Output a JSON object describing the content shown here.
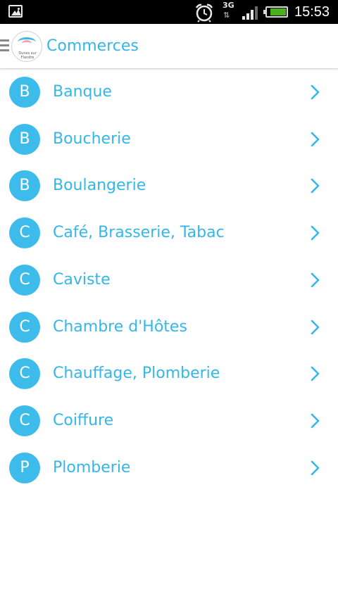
{
  "status_bar": {
    "time": "15:53",
    "network": "3G",
    "network_arrows": "⇅",
    "signal_level": 0.75,
    "battery_level": 0.85,
    "colors": {
      "background": "#000000",
      "battery": "#4caf1e"
    },
    "icons": [
      "gallery-notification-icon",
      "alarm-icon",
      "network-3g-icon",
      "signal-icon",
      "battery-icon"
    ]
  },
  "action_bar": {
    "title": "Commerces",
    "logo_text": "Dunes sur Flandre",
    "icons": [
      "drawer-menu-icon",
      "app-logo"
    ]
  },
  "list": {
    "items": [
      {
        "letter": "B",
        "label": "Banque"
      },
      {
        "letter": "B",
        "label": "Boucherie"
      },
      {
        "letter": "B",
        "label": "Boulangerie"
      },
      {
        "letter": "C",
        "label": "Café, Brasserie, Tabac"
      },
      {
        "letter": "C",
        "label": "Caviste"
      },
      {
        "letter": "C",
        "label": "Chambre d'Hôtes"
      },
      {
        "letter": "C",
        "label": "Chauffage, Plomberie"
      },
      {
        "letter": "C",
        "label": "Coiffure"
      },
      {
        "letter": "P",
        "label": "Plomberie"
      }
    ],
    "item_icon": "chevron-right-icon"
  },
  "colors": {
    "accent": "#34b7e8",
    "avatar": "#3dbbea",
    "background": "#ffffff"
  }
}
